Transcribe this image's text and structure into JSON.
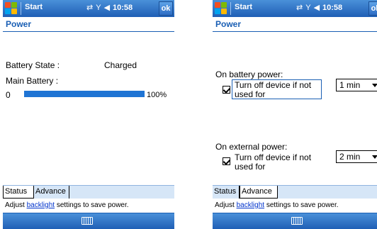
{
  "screens": [
    {
      "titlebar": {
        "title": "Start",
        "time": "10:58",
        "ok": "ok"
      },
      "header": {
        "title": "Power"
      },
      "status": {
        "battery_state_label": "Battery State :",
        "battery_state_value": "Charged",
        "main_battery_label": "Main Battery :",
        "min_label": "0",
        "percent_label": "100%",
        "level_fraction": 1.0
      },
      "tabs": [
        "Status",
        "Advance"
      ],
      "active_tab": "Status",
      "help": {
        "before": "Adjust ",
        "link": "backlight",
        "after": " settings to save power."
      }
    },
    {
      "titlebar": {
        "title": "Start",
        "time": "10:58",
        "ok": "ok"
      },
      "header": {
        "title": "Power"
      },
      "advance": {
        "battery": {
          "heading": "On battery power:",
          "checkbox_line1": "Turn off device if not",
          "checkbox_line2": "used for",
          "checked": true,
          "selected": "1 min"
        },
        "external": {
          "heading": "On external power:",
          "checkbox_line1": "Turn off device if not",
          "checkbox_line2": "used for",
          "checked": true,
          "selected": "2 min"
        }
      },
      "tabs": [
        "Status",
        "Advance"
      ],
      "active_tab": "Advance",
      "help": {
        "before": "Adjust ",
        "link": "backlight",
        "after": " settings to save power."
      }
    }
  ],
  "icons": [
    "windows-logo-icon",
    "connectivity-icon",
    "signal-icon",
    "speaker-icon",
    "keyboard-icon"
  ],
  "colors": {
    "titlebar": "#1f5fb5",
    "accent": "#1a5fb4",
    "progress": "#1f74d4",
    "tabbar": "#d6e6f7"
  }
}
